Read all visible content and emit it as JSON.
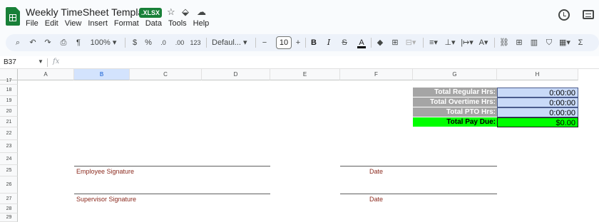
{
  "app": {
    "title": "Weekly TimeSheet Template",
    "file_badge": ".XLSX",
    "menu": [
      "File",
      "Edit",
      "View",
      "Insert",
      "Format",
      "Data",
      "Tools",
      "Help"
    ]
  },
  "toolbar": {
    "zoom": "100%",
    "currency": "$",
    "percent": "%",
    "decrease_decimal": ".0",
    "increase_decimal": ".00",
    "number_format": "123",
    "font": "Defaul...",
    "font_size": "10",
    "bold": "B",
    "italic": "I",
    "text_color": "A"
  },
  "formula_bar": {
    "cell_ref": "B37",
    "fx": "fx",
    "content": ""
  },
  "sheet": {
    "columns": [
      "A",
      "B",
      "C",
      "D",
      "E",
      "F",
      "G",
      "H"
    ],
    "selected_column": "B",
    "rows": [
      "17",
      "18",
      "19",
      "20",
      "21",
      "22",
      "23",
      "24",
      "25",
      "26",
      "27",
      "28",
      "29"
    ],
    "summary": [
      {
        "label": "Total Regular Hrs:",
        "value": "0:00:00"
      },
      {
        "label": "Total Overtime Hrs:",
        "value": "0:00:00"
      },
      {
        "label": "Total PTO Hrs:",
        "value": "0:00:00"
      },
      {
        "label": "Total Pay Due:",
        "value": "$0.00"
      }
    ],
    "signatures": {
      "employee": "Employee Signature",
      "employee_date": "Date",
      "supervisor": "Supervisor Signature",
      "supervisor_date": "Date"
    }
  },
  "colors": {
    "summary_label_bg": "#a5a5a5",
    "summary_value_bg": "#c9daf8",
    "pay_due_bg": "#00ff00",
    "signature_text": "#8b2a1e"
  }
}
